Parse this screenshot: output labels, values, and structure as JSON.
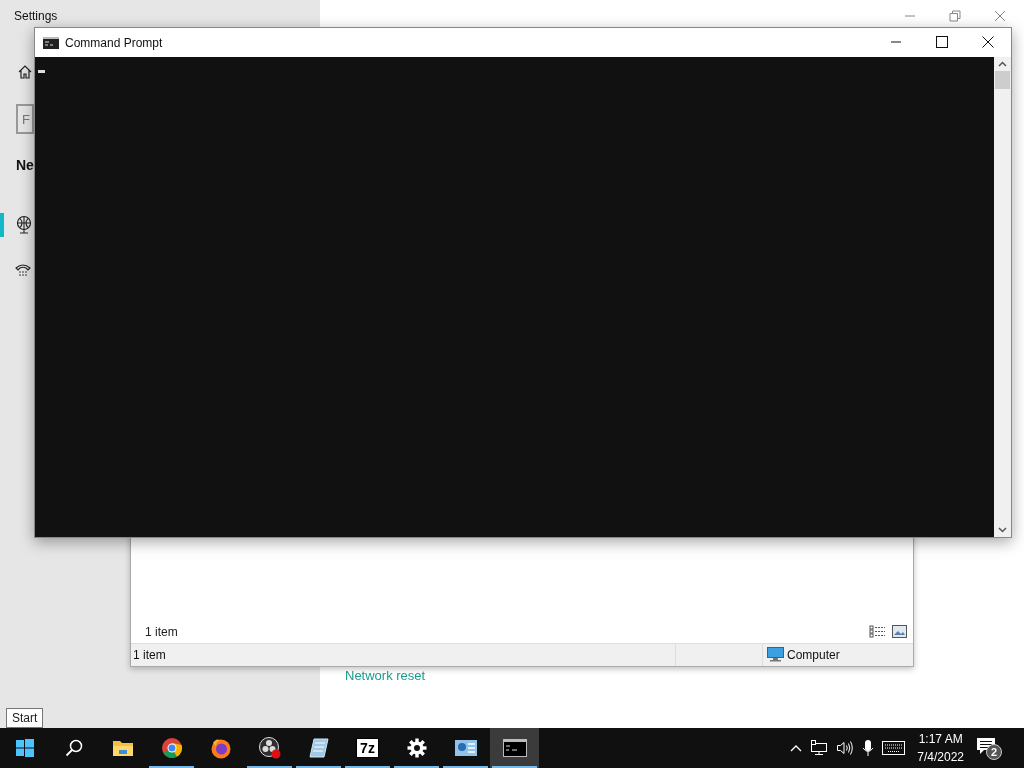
{
  "settings": {
    "title": "Settings",
    "search": {
      "placeholder": "F"
    },
    "heading": "Ne",
    "nav": [
      {
        "kind": "ethernet",
        "selected": true
      },
      {
        "kind": "dialup",
        "selected": false
      }
    ],
    "link": "Network reset"
  },
  "explorer": {
    "item_count": "1 item",
    "status_text": "1 item",
    "location": "Computer"
  },
  "cmd": {
    "title": "Command Prompt"
  },
  "tooltip": "Start",
  "taskbar": {
    "apps": [
      {
        "kind": "explorer",
        "running": false,
        "selected": false
      },
      {
        "kind": "chrome",
        "running": true,
        "selected": false
      },
      {
        "kind": "firefox",
        "running": false,
        "selected": false
      },
      {
        "kind": "obs",
        "running": true,
        "selected": false
      },
      {
        "kind": "notepad",
        "running": true,
        "selected": false
      },
      {
        "kind": "sevenzip",
        "label": "7z",
        "running": true,
        "selected": false
      },
      {
        "kind": "gear",
        "running": true,
        "selected": false
      },
      {
        "kind": "controlpanel",
        "running": true,
        "selected": false
      },
      {
        "kind": "cmd",
        "running": true,
        "selected": true
      }
    ],
    "time": "1:17 AM",
    "date": "7/4/2022",
    "notifications": "2"
  }
}
